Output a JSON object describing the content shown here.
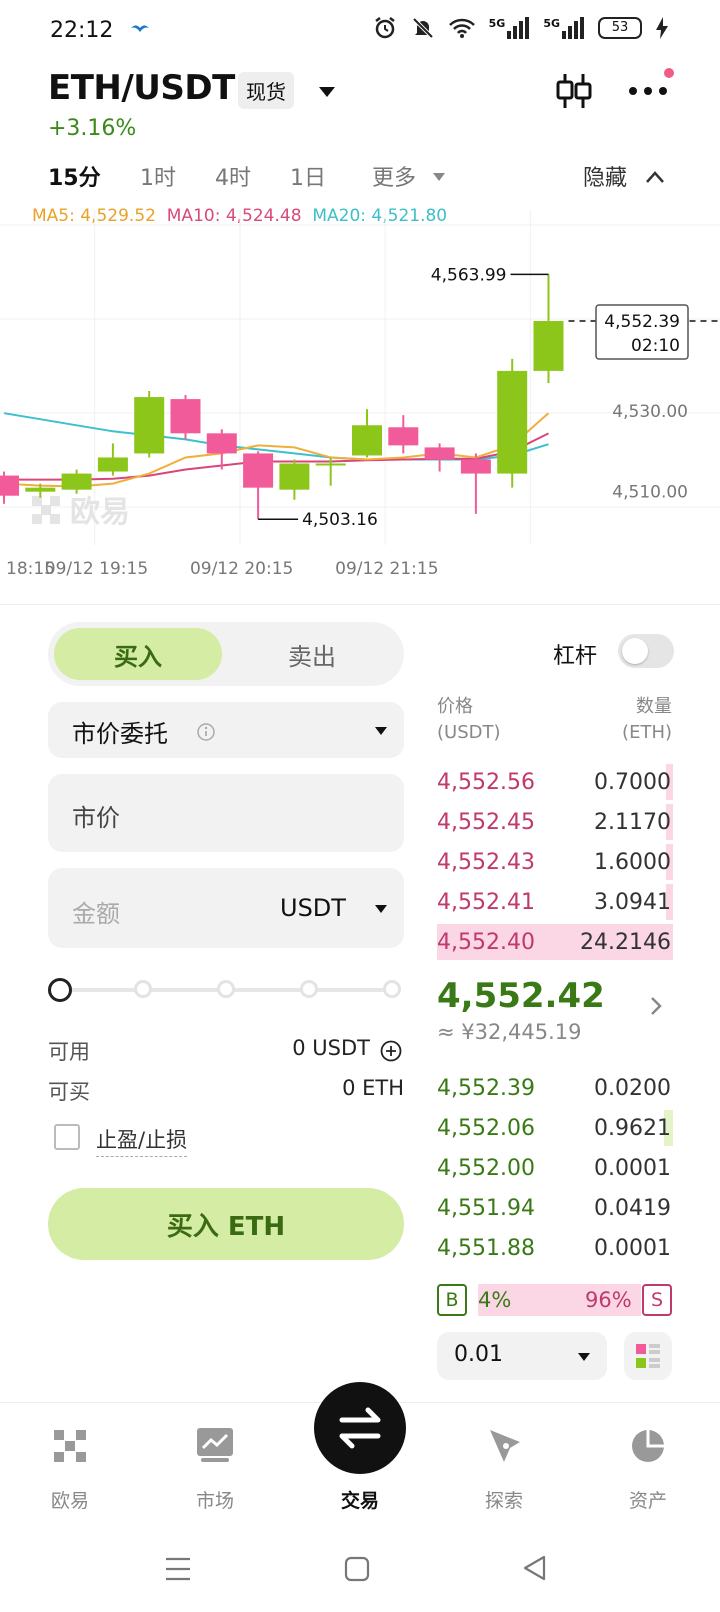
{
  "status_bar": {
    "time": "22:12",
    "battery": "53",
    "net1": "5G",
    "net2": "5G"
  },
  "header": {
    "pair": "ETH/USDT",
    "market_type": "现货",
    "change_pct": "+3.16%"
  },
  "timeframes": {
    "tabs": [
      "15分",
      "1时",
      "4时",
      "1日",
      "更多"
    ],
    "active": "15分",
    "hide_label": "隐藏"
  },
  "ma": {
    "ma5": "MA5: 4,529.52",
    "ma10": "MA10: 4,524.48",
    "ma20": "MA20: 4,521.80"
  },
  "chart_data": {
    "type": "candlestick",
    "x_labels": [
      "18:15",
      "09/12 19:15",
      "09/12 20:15",
      "09/12 21:15"
    ],
    "y_labels": [
      "4,530.00",
      "4,510.00"
    ],
    "high_label": "4,563.99",
    "low_label": "4,503.16",
    "current_price_label": "4,552.39",
    "countdown_label": "02:10",
    "watermark": "欧易",
    "ylim": [
      4498,
      4575
    ],
    "candles": [
      {
        "o": 4514.0,
        "c": 4509.0,
        "h": 4515.0,
        "l": 4507.0
      },
      {
        "o": 4510.0,
        "c": 4511.0,
        "h": 4512.0,
        "l": 4508.5
      },
      {
        "o": 4510.5,
        "c": 4514.5,
        "h": 4515.5,
        "l": 4509.5
      },
      {
        "o": 4515.0,
        "c": 4518.5,
        "h": 4522.0,
        "l": 4514.0
      },
      {
        "o": 4519.5,
        "c": 4533.5,
        "h": 4535.0,
        "l": 4518.5
      },
      {
        "o": 4533.0,
        "c": 4524.5,
        "h": 4534.0,
        "l": 4523.0
      },
      {
        "o": 4524.5,
        "c": 4519.5,
        "h": 4525.5,
        "l": 4515.5
      },
      {
        "o": 4519.5,
        "c": 4511.0,
        "h": 4520.0,
        "l": 4503.16
      },
      {
        "o": 4510.5,
        "c": 4517.0,
        "h": 4518.0,
        "l": 4508.0
      },
      {
        "o": 4517.0,
        "c": 4517.0,
        "h": 4518.5,
        "l": 4511.5
      },
      {
        "o": 4519.0,
        "c": 4526.5,
        "h": 4530.5,
        "l": 4518.5
      },
      {
        "o": 4526.0,
        "c": 4521.5,
        "h": 4529.0,
        "l": 4519.5
      },
      {
        "o": 4521.0,
        "c": 4518.0,
        "h": 4522.0,
        "l": 4515.0
      },
      {
        "o": 4518.0,
        "c": 4514.5,
        "h": 4519.5,
        "l": 4504.5
      },
      {
        "o": 4514.5,
        "c": 4540.0,
        "h": 4543.0,
        "l": 4511.0
      },
      {
        "o": 4540.0,
        "c": 4552.39,
        "h": 4563.99,
        "l": 4537.0
      }
    ],
    "ma5": [
      4512.0,
      4511.5,
      4511.3,
      4512.0,
      4514.5,
      4518.5,
      4519.5,
      4521.5,
      4521.0,
      4518.5,
      4518.0,
      4518.5,
      4519.5,
      4518.5,
      4521.5,
      4529.52
    ],
    "ma10": [
      4513.0,
      4513.0,
      4513.0,
      4513.2,
      4514.0,
      4515.5,
      4516.5,
      4517.5,
      4517.5,
      4517.5,
      4517.8,
      4518.0,
      4518.2,
      4518.2,
      4520.0,
      4524.48
    ],
    "ma20": [
      4529.5,
      4528.0,
      4526.5,
      4525.0,
      4524.0,
      4523.0,
      4521.5,
      4520.5,
      4519.5,
      4518.5,
      4518.0,
      4518.0,
      4518.0,
      4518.0,
      4519.0,
      4521.8
    ],
    "colors": {
      "up": "#8dc61a",
      "down": "#f25b9a",
      "ma5": "#f0ae3c",
      "ma10": "#d9457a",
      "ma20": "#3cbfd0"
    }
  },
  "order_form": {
    "buy_label": "买入",
    "sell_label": "卖出",
    "leverage_label": "杠杆",
    "leverage_on": false,
    "order_type": "市价委托",
    "price_value": "市价",
    "amount_placeholder": "金额",
    "amount_unit": "USDT",
    "slider_pct": 0,
    "available_label": "可用",
    "available_value": "0 USDT",
    "buyable_label": "可买",
    "buyable_value": "0 ETH",
    "tpsl_label": "止盈/止损",
    "submit_label": "买入 ETH"
  },
  "order_book": {
    "price_header": [
      "价格",
      "(USDT)"
    ],
    "qty_header": [
      "数量",
      "(ETH)"
    ],
    "asks": [
      {
        "price": "4,552.56",
        "qty": "0.7000",
        "depth": 0.03
      },
      {
        "price": "4,552.45",
        "qty": "2.1170",
        "depth": 0.03
      },
      {
        "price": "4,552.43",
        "qty": "1.6000",
        "depth": 0.03
      },
      {
        "price": "4,552.41",
        "qty": "3.0941",
        "depth": 0.03
      },
      {
        "price": "4,552.40",
        "qty": "24.2146",
        "depth": 1.0
      }
    ],
    "last_price": "4,552.42",
    "last_price_cny": "≈ ¥32,445.19",
    "bids": [
      {
        "price": "4,552.39",
        "qty": "0.0200",
        "depth": 0.0
      },
      {
        "price": "4,552.06",
        "qty": "0.9621",
        "depth": 0.04
      },
      {
        "price": "4,552.00",
        "qty": "0.0001",
        "depth": 0.0
      },
      {
        "price": "4,551.94",
        "qty": "0.0419",
        "depth": 0.0
      },
      {
        "price": "4,551.88",
        "qty": "0.0001",
        "depth": 0.0
      }
    ],
    "buy_tag": "B",
    "sell_tag": "S",
    "buy_pct": "4%",
    "sell_pct": "96%",
    "buy_ratio": 0.04,
    "precision": "0.01"
  },
  "bottom_nav": {
    "items": [
      "欧易",
      "市场",
      "交易",
      "探索",
      "资产"
    ],
    "active": "交易"
  }
}
